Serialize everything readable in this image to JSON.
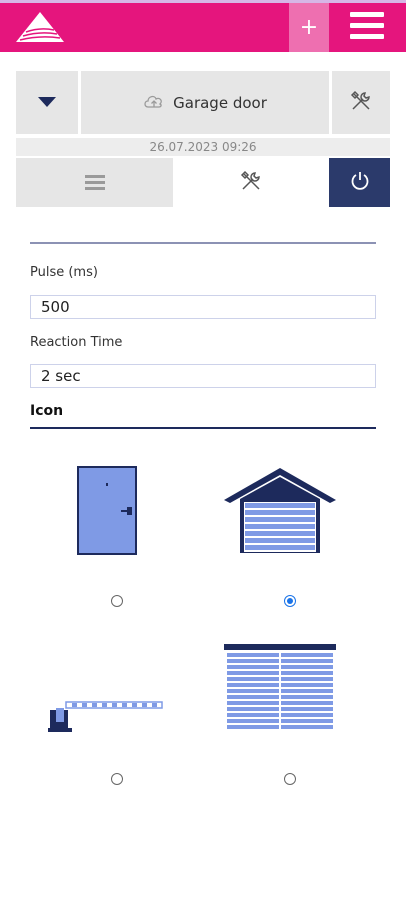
{
  "header": {
    "plus_label": "+",
    "colors": {
      "brand": "#e5157d",
      "plus_bg": "#ee6fb0",
      "accent": "#2b3a6b"
    }
  },
  "device": {
    "title": "Garage door",
    "timestamp": "26.07.2023 09:26",
    "icons": [
      "chevron-down-icon",
      "cloud-upload-icon",
      "tools-icon"
    ]
  },
  "tabs": [
    {
      "name": "list",
      "icon": "hamburger-icon",
      "active": false
    },
    {
      "name": "settings",
      "icon": "tools-icon",
      "active": true
    },
    {
      "name": "power",
      "icon": "power-icon",
      "active": false
    }
  ],
  "form": {
    "pulse_label": "Pulse (ms)",
    "pulse_value": "500",
    "reaction_label": "Reaction Time",
    "reaction_value": "2 sec",
    "icon_heading": "Icon"
  },
  "icon_options": [
    {
      "name": "door",
      "selected": false
    },
    {
      "name": "garage",
      "selected": true
    },
    {
      "name": "barrier",
      "selected": false
    },
    {
      "name": "shutter",
      "selected": false
    }
  ]
}
